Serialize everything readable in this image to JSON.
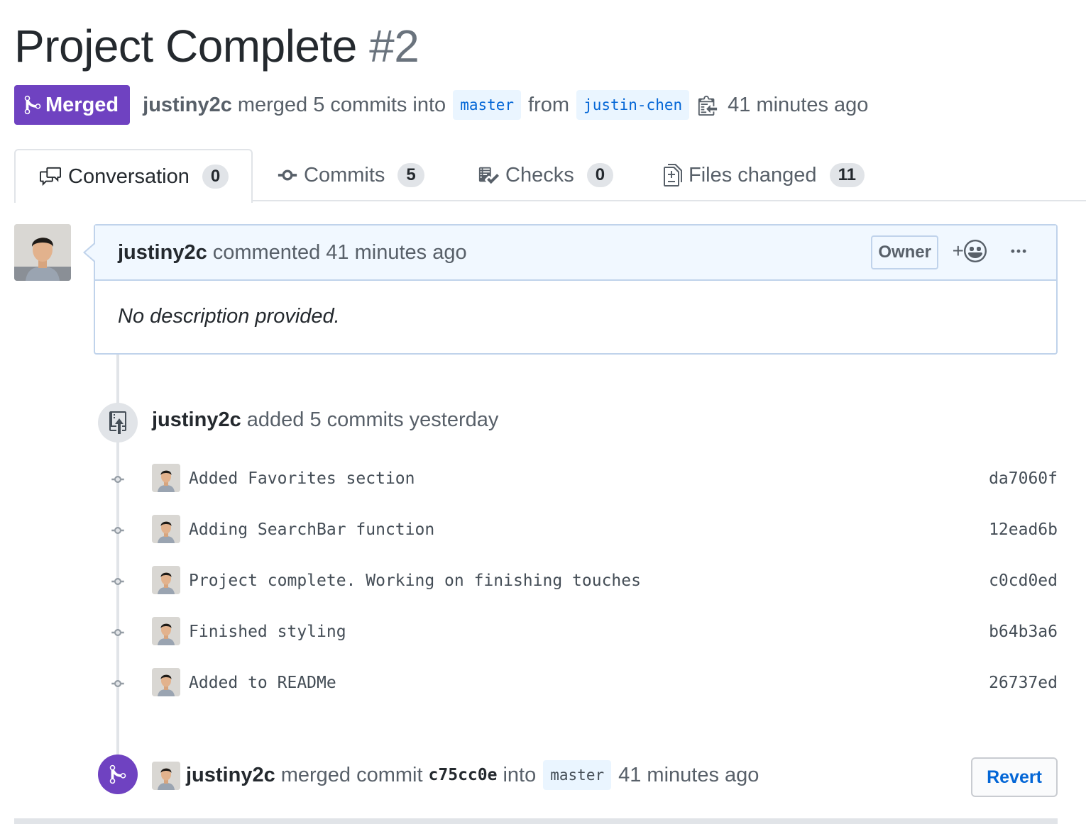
{
  "pr": {
    "title": "Project Complete",
    "number": "#2",
    "state_label": "Merged",
    "author": "justiny2c",
    "merged_text": "merged 5 commits into",
    "base_branch": "master",
    "from_text": "from",
    "head_branch": "justin-chen",
    "time": "41 minutes ago"
  },
  "tabs": [
    {
      "label": "Conversation",
      "count": "0",
      "icon": "comment-discussion-icon"
    },
    {
      "label": "Commits",
      "count": "5",
      "icon": "git-commit-icon"
    },
    {
      "label": "Checks",
      "count": "0",
      "icon": "checklist-icon"
    },
    {
      "label": "Files changed",
      "count": "11",
      "icon": "diff-icon"
    }
  ],
  "comment": {
    "author": "justiny2c",
    "action": "commented 41 minutes ago",
    "role_badge": "Owner",
    "reaction_plus": "+",
    "body": "No description provided."
  },
  "commit_event": {
    "author": "justiny2c",
    "text": "added 5 commits yesterday"
  },
  "commits": [
    {
      "message": "Added Favorites section",
      "sha": "da7060f"
    },
    {
      "message": "Adding SearchBar function",
      "sha": "12ead6b"
    },
    {
      "message": "Project complete. Working on finishing touches",
      "sha": "c0cd0ed"
    },
    {
      "message": "Finished styling",
      "sha": "b64b3a6"
    },
    {
      "message": "Added to READMe",
      "sha": "26737ed"
    }
  ],
  "merge_event": {
    "author": "justiny2c",
    "text_before": "merged commit",
    "sha": "c75cc0e",
    "text_into": "into",
    "branch": "master",
    "time": "41 minutes ago",
    "revert_label": "Revert"
  },
  "colors": {
    "merged_purple": "#6f42c1",
    "link_blue": "#0366d6",
    "branch_bg": "#eaf5ff",
    "comment_header_bg": "#f1f8ff",
    "comment_border": "#c0d3eb"
  }
}
